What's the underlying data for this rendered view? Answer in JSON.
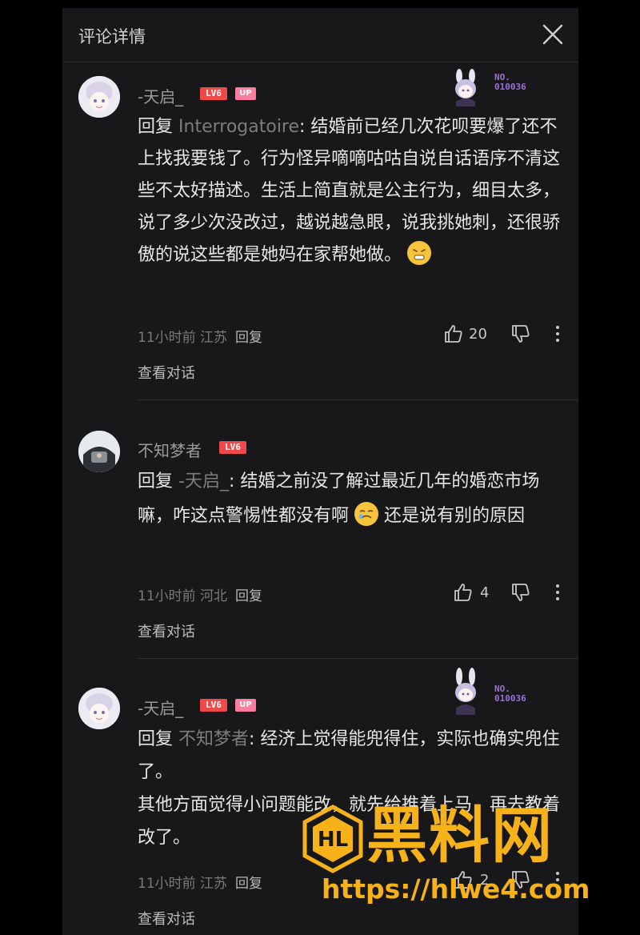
{
  "header": {
    "title": "评论详情"
  },
  "fan_badge_no": "NO.\n010036",
  "comments": [
    {
      "username": "-天启_",
      "level": "LV6",
      "up": "UP",
      "reply_label": "回复",
      "mention": "Interrogatoire",
      "text": ": 结婚前已经几次花呗要爆了还不上找我要钱了。行为怪异嘀嘀咕咕自说自话语序不清这些不太好描述。生活上简直就是公主行为，细目太多，说了多少次没改过，越说越急眼，说我挑她刺，还很骄傲的说这些都是她妈在家帮她做。",
      "time": "11小时前",
      "location": "江苏",
      "reply_button": "回复",
      "likes": "20",
      "view_conversation": "查看对话"
    },
    {
      "username": "不知梦者",
      "level": "LV6",
      "reply_label": "回复",
      "mention": "-天启_",
      "text_before": ": 结婚之前没了解过最近几年的婚恋市场嘛，咋这点警惕性都没有啊",
      "text_after": "还是说有别的原因",
      "time": "11小时前",
      "location": "河北",
      "reply_button": "回复",
      "likes": "4",
      "view_conversation": "查看对话"
    },
    {
      "username": "-天启_",
      "level": "LV6",
      "up": "UP",
      "reply_label": "回复",
      "mention": "不知梦者",
      "line1": ": 经济上觉得能兜得住，实际也确实兜住了。",
      "line2": "其他方面觉得小问题能改，就先给推着上马，再去教着改了。",
      "time": "11小时前",
      "location": "江苏",
      "reply_button": "回复",
      "likes": "2",
      "view_conversation": "查看对话"
    }
  ],
  "watermark": {
    "title": "黑料网",
    "url": "https://hlwe4.com",
    "logo_text": "HL"
  },
  "colors": {
    "background": "#18181a",
    "level_badge": "#ee4a4a",
    "up_badge": "#fb7da0",
    "watermark": "#f7b21a"
  }
}
